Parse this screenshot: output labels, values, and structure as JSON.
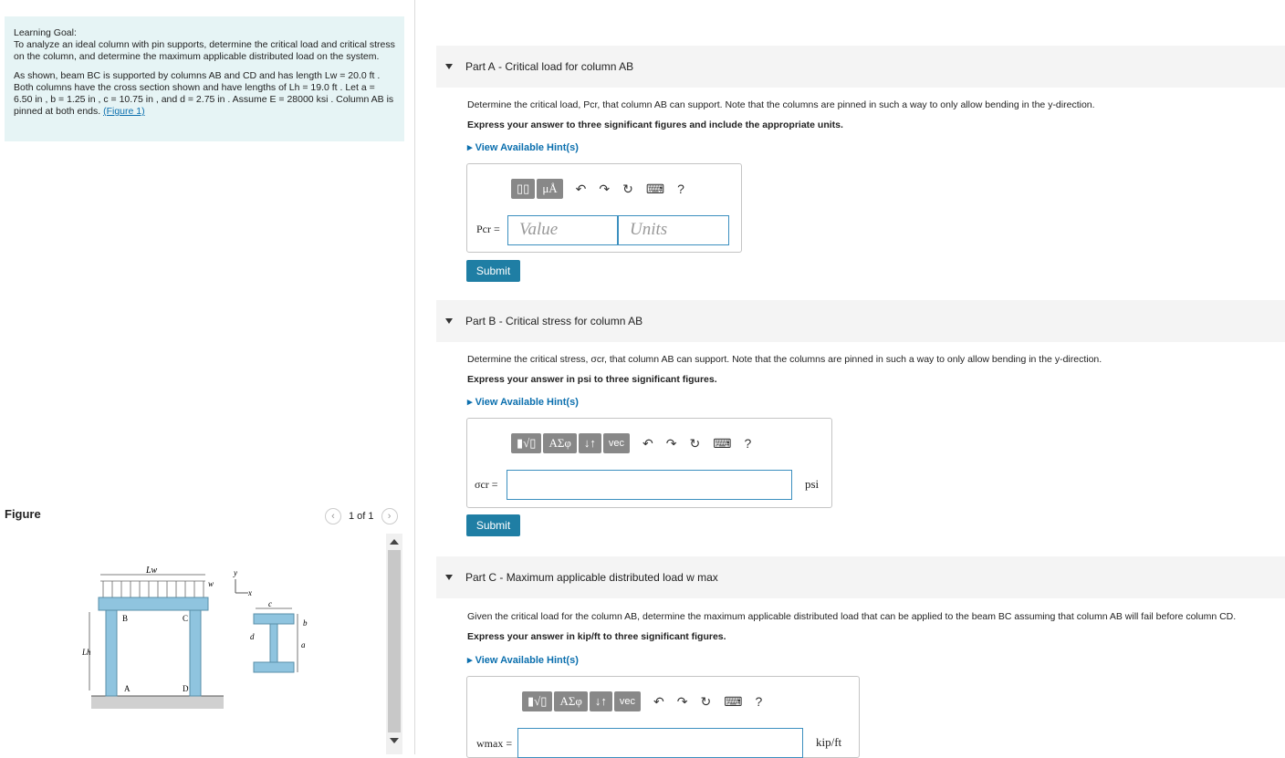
{
  "goal": {
    "heading": "Learning Goal:",
    "text": "To analyze an ideal column with pin supports, determine the critical load and critical stress on the column, and determine the maximum applicable distributed load on the system.",
    "details": "As shown, beam BC is supported by columns AB and CD and has length Lw = 20.0 ft . Both columns have the cross section shown and have lengths of Lh = 19.0 ft . Let a = 6.50 in , b = 1.25 in , c = 10.75 in , and d = 2.75 in . Assume E = 28000 ksi . Column AB is pinned at both ends.",
    "figure_link": "(Figure 1)"
  },
  "figure": {
    "title": "Figure",
    "pager": "1 of 1",
    "labels": {
      "lw": "Lw",
      "w": "w",
      "y": "y",
      "x": "x",
      "b": "B",
      "c": "C",
      "a": "A",
      "d": "D",
      "lh": "Lh",
      "c_dim": "c",
      "d_dim": "d",
      "b_dim": "b",
      "a_dim": "a"
    }
  },
  "partA": {
    "label": "Part A",
    "title": "Critical load for column AB",
    "question": "Determine the critical load, Pcr, that column AB can support. Note that the columns are pinned in such a way to only allow bending in the y-direction.",
    "instruction": "Express your answer to three significant figures and include the appropriate units.",
    "hint": "View Available Hint(s)",
    "var_label": "Pcr =",
    "value_placeholder": "Value",
    "units_placeholder": "Units",
    "toolbar": [
      "▯▯",
      "μÅ",
      "↶",
      "↷",
      "↻",
      "⌨",
      "?"
    ],
    "submit": "Submit"
  },
  "partB": {
    "label": "Part B",
    "title": "Critical stress for column AB",
    "question": "Determine the critical stress, σcr, that column AB can support. Note that the columns are pinned in such a way to only allow bending in the y-direction.",
    "instruction": "Express your answer in psi to three significant figures.",
    "hint": "View Available Hint(s)",
    "var_label": "σcr =",
    "unit": "psi",
    "toolbar": [
      "▮√▯",
      "ΑΣφ",
      "↓↑",
      "vec",
      "↶",
      "↷",
      "↻",
      "⌨",
      "?"
    ],
    "submit": "Submit"
  },
  "partC": {
    "label": "Part C",
    "title": "Maximum applicable distributed load w max",
    "question": "Given the critical load for the column AB, determine the maximum applicable distributed load that can be applied to the beam BC assuming that column AB will fail before column CD.",
    "instruction": "Express your answer in kip/ft to three significant figures.",
    "hint": "View Available Hint(s)",
    "var_label": "wmax =",
    "unit": "kip/ft",
    "toolbar": [
      "▮√▯",
      "ΑΣφ",
      "↓↑",
      "vec",
      "↶",
      "↷",
      "↻",
      "⌨",
      "?"
    ]
  }
}
